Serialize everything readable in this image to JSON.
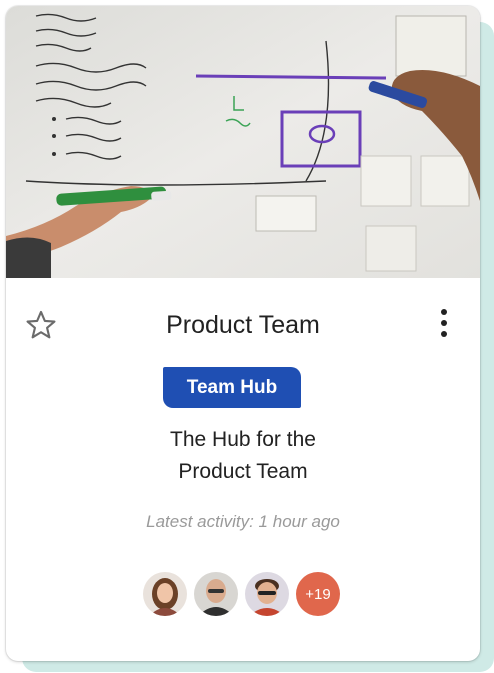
{
  "card": {
    "title": "Product Team",
    "badge": "Team Hub",
    "description_line1": "The Hub for the",
    "description_line2": "Product Team",
    "activity": "Latest activity: 1 hour ago",
    "favorite_icon": "star-outline-icon",
    "menu_icon": "more-vert-icon",
    "more_members": "+19",
    "colors": {
      "badge": "#1f4fb3",
      "more_members": "#e0674c",
      "backdrop": "#cfeae6"
    }
  }
}
